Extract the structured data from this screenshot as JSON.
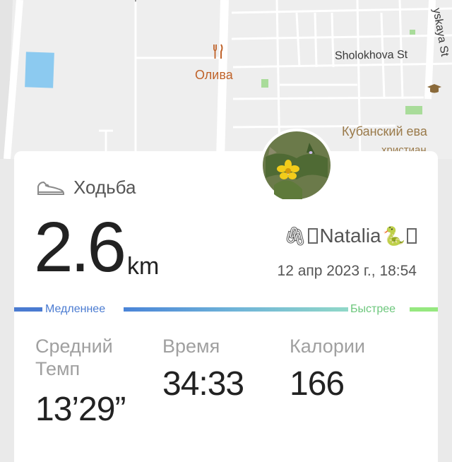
{
  "map": {
    "labels": {
      "street_1": "Sholokhova St",
      "street_2": "yskaya St",
      "street_3": "T",
      "poi_restaurant": "Олива",
      "poi_church_line1": "Кубанский ева",
      "poi_church_line2": "христиан"
    },
    "colors": {
      "water": "#8ccaf0",
      "park": "#a9dc9a",
      "poi": "#c0632a"
    }
  },
  "activity": {
    "icon": "sneaker-icon",
    "label": "Ходьба"
  },
  "distance": {
    "value": "2.6",
    "unit": "km"
  },
  "user": {
    "name": "Natalia",
    "emoji_left": "🖇",
    "emoji_right": "🐍"
  },
  "datetime": "12 апр 2023 г., 18:54",
  "pace_scale": {
    "slower_label": "Медленнее",
    "faster_label": "Быстрее",
    "colors": {
      "slow": "#4a7bd1",
      "fast": "#96e880"
    }
  },
  "stats": [
    {
      "label": "Средний Темп",
      "value": "13’29”"
    },
    {
      "label": "Время",
      "value": "34:33"
    },
    {
      "label": "Калории",
      "value": "166"
    }
  ]
}
